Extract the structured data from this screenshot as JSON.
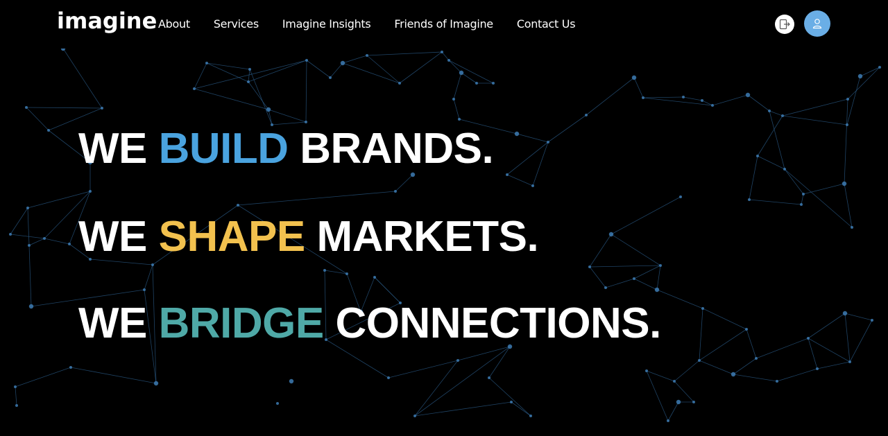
{
  "header": {
    "logo": "imagine",
    "nav": [
      {
        "label": "About"
      },
      {
        "label": "Services"
      },
      {
        "label": "Imagine Insights"
      },
      {
        "label": "Friends of Imagine"
      },
      {
        "label": "Contact Us"
      }
    ],
    "logout_icon": "logout-icon",
    "avatar_icon": "user-icon"
  },
  "hero": {
    "lines": [
      {
        "prefix": "WE",
        "highlight": "BUILD",
        "suffix": "BRANDS.",
        "highlight_color": "#4aa3df"
      },
      {
        "prefix": "WE",
        "highlight": "SHAPE",
        "suffix": "MARKETS.",
        "highlight_color": "#f2c14e"
      },
      {
        "prefix": "WE",
        "highlight": "BRIDGE",
        "suffix": "CONNECTIONS.",
        "highlight_color": "#4fa9a7"
      }
    ]
  },
  "colors": {
    "background": "#000000",
    "text": "#ffffff",
    "network_line": "#2a5a85",
    "network_node": "#3d7bb3",
    "avatar_bg": "#6aaee6"
  }
}
